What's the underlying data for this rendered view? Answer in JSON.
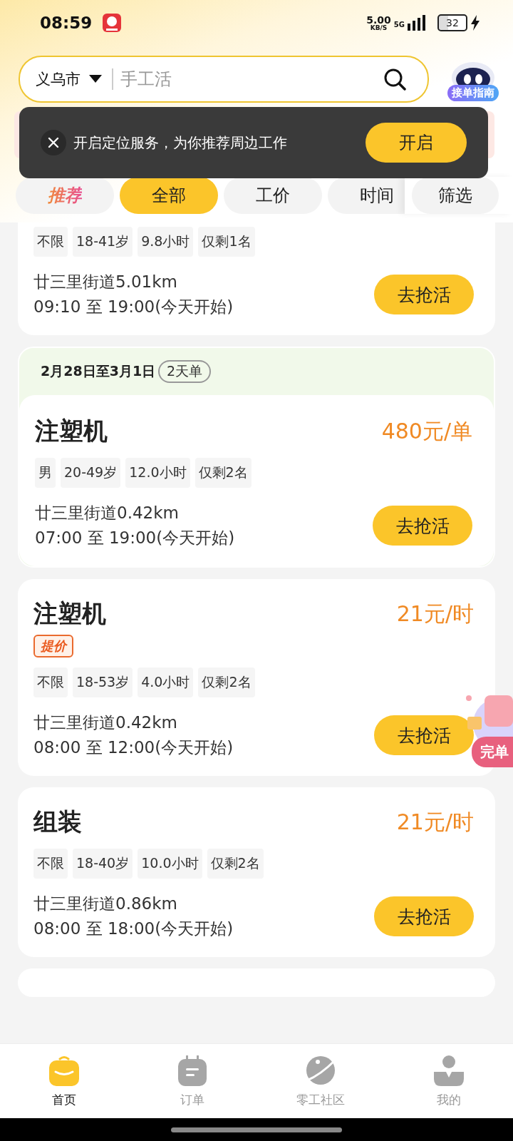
{
  "status_bar": {
    "time": "08:59",
    "speed": "5.00",
    "speed_unit": "KB/S",
    "network": "5G",
    "battery": "32"
  },
  "search": {
    "city": "义乌市",
    "placeholder": "手工活"
  },
  "guide_badge": "接单指南",
  "toast": {
    "message": "开启定位服务，为你推荐周边工作",
    "button": "开启"
  },
  "tabs": [
    {
      "label": "推荐",
      "kind": "promo",
      "selected": false
    },
    {
      "label": "全部",
      "kind": "plain",
      "selected": true
    },
    {
      "label": "工价",
      "kind": "plain",
      "selected": false
    },
    {
      "label": "时间",
      "kind": "plain",
      "selected": false
    }
  ],
  "filter": "筛选",
  "jobs": [
    {
      "tags": [
        "不限",
        "18-41岁",
        "9.8小时",
        "仅剩1名"
      ],
      "location": "廿三里街道5.01km",
      "time": "09:10 至 19:00(今天开始)",
      "button": "去抢活"
    },
    {
      "period": "2月28日至3月1日",
      "period_badge": "2天单",
      "title": "注塑机",
      "price": "480元/单",
      "tags": [
        "男",
        "20-49岁",
        "12.0小时",
        "仅剩2名"
      ],
      "location": "廿三里街道0.42km",
      "time": "07:00 至 19:00(今天开始)",
      "button": "去抢活"
    },
    {
      "title": "注塑机",
      "price": "21元/时",
      "badge": "提价",
      "tags": [
        "不限",
        "18-53岁",
        "4.0小时",
        "仅剩2名"
      ],
      "location": "廿三里街道0.42km",
      "time": "08:00 至 12:00(今天开始)",
      "button": "去抢活"
    },
    {
      "title": "组装",
      "price": "21元/时",
      "tags": [
        "不限",
        "18-40岁",
        "10.0小时",
        "仅剩2名"
      ],
      "location": "廿三里街道0.86km",
      "time": "08:00 至 18:00(今天开始)",
      "button": "去抢活"
    }
  ],
  "floating_badge": "完单",
  "bottom_nav": [
    {
      "label": "首页",
      "kind": "bag",
      "selected": true
    },
    {
      "label": "订单",
      "kind": "note",
      "selected": false
    },
    {
      "label": "零工社区",
      "kind": "planet",
      "selected": false
    },
    {
      "label": "我的",
      "kind": "person",
      "selected": false
    }
  ]
}
